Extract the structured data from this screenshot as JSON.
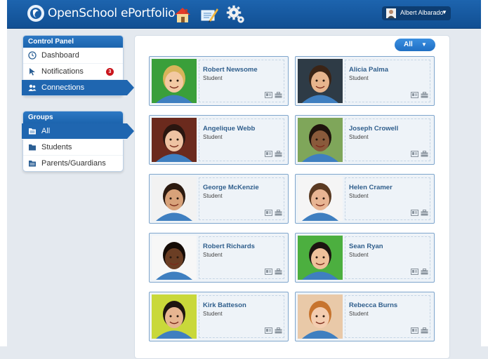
{
  "app": {
    "title": "OpenSchool ePortfolio"
  },
  "user": {
    "name": "Albert Albarado",
    "caret": "▼"
  },
  "control_panel": {
    "title": "Control Panel",
    "items": [
      {
        "label": "Dashboard",
        "icon": "clock-icon"
      },
      {
        "label": "Notifications",
        "icon": "cursor-icon",
        "badge": "3"
      },
      {
        "label": "Connections",
        "icon": "people-icon",
        "active": true
      }
    ]
  },
  "groups": {
    "title": "Groups",
    "items": [
      {
        "label": "All",
        "active": true
      },
      {
        "label": "Students"
      },
      {
        "label": "Parents/Guardians"
      }
    ]
  },
  "filter": {
    "label": "All",
    "caret": "▼"
  },
  "students": [
    {
      "name": "Robert Newsome",
      "role": "Student",
      "bg": "#3a9f3a",
      "skin": "#f3c9a3",
      "hair": "#d8b45a"
    },
    {
      "name": "Alicia Palma",
      "role": "Student",
      "bg": "#2e3b46",
      "skin": "#e7b48d",
      "hair": "#3b2416"
    },
    {
      "name": "Angelique Webb",
      "role": "Student",
      "bg": "#6b2a1d",
      "skin": "#efc3a3",
      "hair": "#2a1610"
    },
    {
      "name": "Joseph Crowell",
      "role": "Student",
      "bg": "#7fa65a",
      "skin": "#8a5a3b",
      "hair": "#1f140d"
    },
    {
      "name": "George McKenzie",
      "role": "Student",
      "bg": "#f2f2f2",
      "skin": "#d8a27a",
      "hair": "#2c1a10"
    },
    {
      "name": "Helen Cramer",
      "role": "Student",
      "bg": "#f5f5f5",
      "skin": "#e8b593",
      "hair": "#5a3a22"
    },
    {
      "name": "Robert Richards",
      "role": "Student",
      "bg": "#f7f7f7",
      "skin": "#6b3e24",
      "hair": "#150c07"
    },
    {
      "name": "Sean Ryan",
      "role": "Student",
      "bg": "#4caf3f",
      "skin": "#efc19b",
      "hair": "#1c1511"
    },
    {
      "name": "Kirk Batteson",
      "role": "Student",
      "bg": "#c9d83a",
      "skin": "#e7b591",
      "hair": "#1d1510"
    },
    {
      "name": "Rebecca Burns",
      "role": "Student",
      "bg": "#e9c9a8",
      "skin": "#f4cdb0",
      "hair": "#c7742e"
    }
  ],
  "colors": {
    "topbar": "#1d64ae",
    "accent": "#1f66b0",
    "badge": "#c9161d",
    "name_text": "#2f5e8c"
  }
}
